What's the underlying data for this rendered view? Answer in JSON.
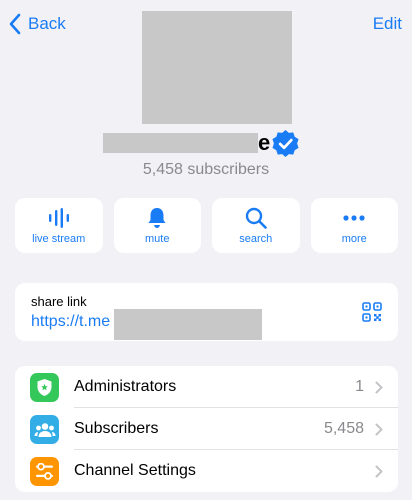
{
  "nav": {
    "back_label": "Back",
    "edit_label": "Edit"
  },
  "channel": {
    "title_visible_tail": "e",
    "subscribers_text": "5,458 subscribers"
  },
  "actions": [
    {
      "label": "live stream",
      "icon": "live-stream-icon"
    },
    {
      "label": "mute",
      "icon": "bell-icon"
    },
    {
      "label": "search",
      "icon": "search-icon"
    },
    {
      "label": "more",
      "icon": "more-icon"
    }
  ],
  "share": {
    "label": "share link",
    "url_visible": "https://t.me"
  },
  "settings": [
    {
      "label": "Administrators",
      "value": "1",
      "icon": "shield-icon",
      "color": "#34c759"
    },
    {
      "label": "Subscribers",
      "value": "5,458",
      "icon": "users-icon",
      "color": "#32ade6"
    },
    {
      "label": "Channel Settings",
      "value": "",
      "icon": "sliders-icon",
      "color": "#ff9500"
    }
  ],
  "colors": {
    "accent": "#1a7cf5",
    "background": "#f2f2f6",
    "secondary_text": "#8a8a8e"
  }
}
